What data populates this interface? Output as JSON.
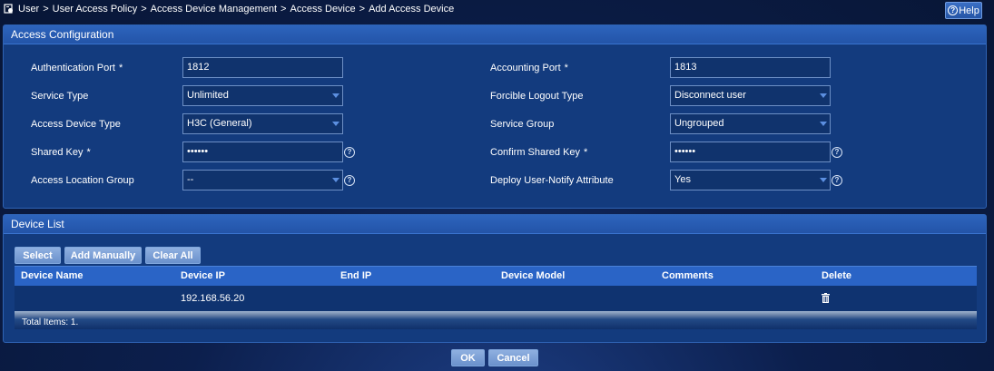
{
  "breadcrumb": {
    "items": [
      "User",
      "User Access Policy",
      "Access Device Management",
      "Access Device",
      "Add Access Device"
    ],
    "separator": ">"
  },
  "help_label": "Help",
  "access_config": {
    "title": "Access Configuration",
    "required_mark": "*",
    "authentication_port": {
      "label": "Authentication Port",
      "value": "1812"
    },
    "accounting_port": {
      "label": "Accounting Port",
      "value": "1813"
    },
    "service_type": {
      "label": "Service Type",
      "value": "Unlimited"
    },
    "forcible_logout_type": {
      "label": "Forcible Logout Type",
      "value": "Disconnect user"
    },
    "access_device_type": {
      "label": "Access Device Type",
      "value": "H3C (General)"
    },
    "service_group": {
      "label": "Service Group",
      "value": "Ungrouped"
    },
    "shared_key": {
      "label": "Shared Key",
      "value": "••••••"
    },
    "confirm_shared_key": {
      "label": "Confirm Shared Key",
      "value": "••••••"
    },
    "access_location_group": {
      "label": "Access Location Group",
      "value": "--"
    },
    "deploy_user_notify": {
      "label": "Deploy User-Notify Attribute",
      "value": "Yes"
    }
  },
  "device_list": {
    "title": "Device List",
    "buttons": {
      "select": "Select",
      "add_manually": "Add Manually",
      "clear_all": "Clear All"
    },
    "columns": [
      "Device Name",
      "Device IP",
      "End IP",
      "Device Model",
      "Comments",
      "Delete"
    ],
    "rows": [
      {
        "device_name": "",
        "device_ip": "192.168.56.20",
        "end_ip": "",
        "device_model": "",
        "comments": ""
      }
    ],
    "total": "Total Items: 1."
  },
  "footer": {
    "ok": "OK",
    "cancel": "Cancel"
  },
  "colors": {
    "panel": "#133b7e",
    "header": "#2a64c6",
    "button": "#7b9fd6",
    "background": "#0c1f4d"
  }
}
